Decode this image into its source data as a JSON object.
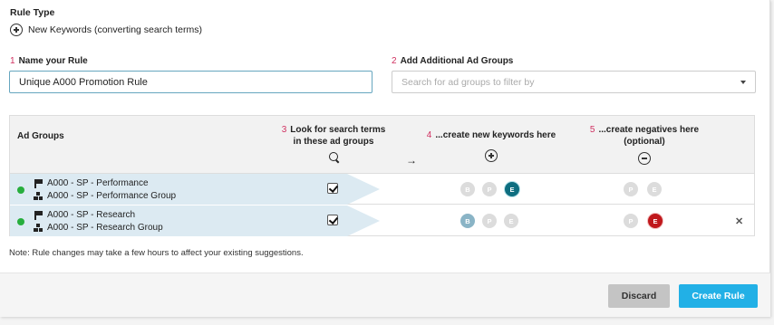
{
  "rule_type": {
    "label": "Rule Type",
    "value": "New Keywords (converting search terms)",
    "icon": "circle-plus-icon"
  },
  "name_rule": {
    "step": "1",
    "label": "Name your Rule",
    "value": "Unique A000 Promotion Rule"
  },
  "add_groups": {
    "step": "2",
    "label": "Add Additional Ad Groups",
    "placeholder": "Search for ad groups to filter by"
  },
  "table": {
    "header": {
      "ad_groups": "Ad Groups",
      "col3_step": "3",
      "col3_line1": "Look for search terms",
      "col3_line2": "in these ad groups",
      "col4_step": "4",
      "col4_label": "...create new keywords here",
      "col5_step": "5",
      "col5_line1": "...create negatives here",
      "col5_line2": "(optional)"
    },
    "rows": [
      {
        "campaign": "A000 - SP - Performance",
        "ad_group": "A000 - SP - Performance Group",
        "status_color": "#27ae3d",
        "checked": true,
        "keyword_types": [
          "B",
          "P",
          "E"
        ],
        "keyword_active": "E",
        "negative_types": [
          "P",
          "E"
        ],
        "negative_active": ""
      },
      {
        "campaign": "A000 - SP - Research",
        "ad_group": "A000 - SP - Research Group",
        "status_color": "#27ae3d",
        "checked": true,
        "keyword_types": [
          "B",
          "P",
          "E"
        ],
        "keyword_active": "B",
        "negative_types": [
          "P",
          "E"
        ],
        "negative_active": "E"
      }
    ]
  },
  "note": "Note: Rule changes may take a few hours to affect your existing suggestions.",
  "buttons": {
    "discard": "Discard",
    "create": "Create Rule"
  },
  "colors": {
    "accent": "#22b0e6",
    "exact_active": "#0e6e80",
    "broad_active": "#8ab4c6",
    "negative_active": "#c0181c",
    "step_number": "#d03060",
    "highlight": "#dceaf2"
  }
}
